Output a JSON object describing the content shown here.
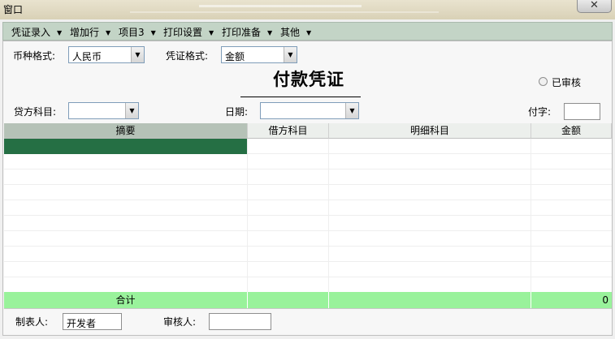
{
  "window": {
    "title": "窗口",
    "close_glyph": "✕"
  },
  "menu": {
    "items": [
      {
        "label": "凭证录入",
        "arrow": "▼"
      },
      {
        "label": "增加行",
        "arrow": "▼"
      },
      {
        "label": "项目3",
        "arrow": "▼"
      },
      {
        "label": "打印设置",
        "arrow": "▼"
      },
      {
        "label": "打印准备",
        "arrow": "▼"
      },
      {
        "label": "其他",
        "arrow": "▼"
      }
    ]
  },
  "form": {
    "currency_format_label": "币种格式:",
    "currency_value": "人民币",
    "voucher_format_label": "凭证格式:",
    "voucher_format_value": "金额",
    "voucher_title": "付款凭证",
    "approved_label": "已审核",
    "credit_account_label": "贷方科目:",
    "credit_account_value": "",
    "date_label": "日期:",
    "date_value": "",
    "voucher_no_label": "付字:",
    "voucher_no_value": "",
    "dropdown_arrow": "▼"
  },
  "grid": {
    "columns": [
      "摘要",
      "借方科目",
      "明细科目",
      "金额"
    ],
    "total_label": "合计",
    "total_amount": "0"
  },
  "footer": {
    "preparer_label": "制表人:",
    "preparer_value": "开发者",
    "reviewer_label": "审核人:",
    "reviewer_value": ""
  },
  "colors": {
    "menu_bg": "#c3d4c6",
    "selected_cell": "#256f44",
    "total_row": "#99f29b"
  }
}
